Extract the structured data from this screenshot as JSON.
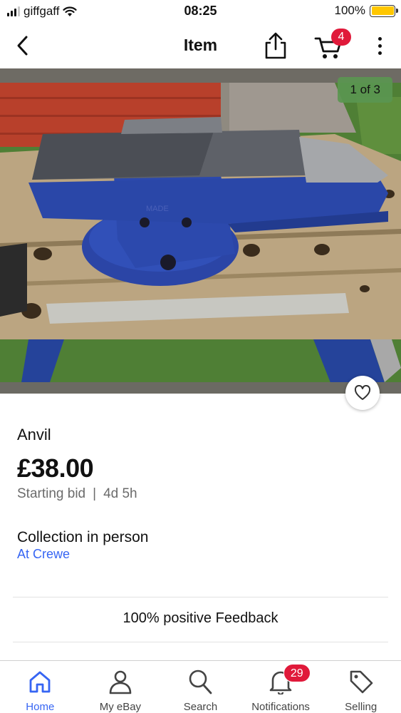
{
  "status_bar": {
    "carrier": "giffgaff",
    "time": "08:25",
    "battery": "100%",
    "battery_level": 1.0,
    "icons": [
      "signal-icon",
      "wifi-icon",
      "battery-icon"
    ]
  },
  "nav": {
    "title": "Item",
    "cart_count": "4",
    "icons": [
      "back-chevron-icon",
      "share-icon",
      "cart-icon",
      "more-vertical-icon"
    ]
  },
  "gallery": {
    "counter": "1 of 3",
    "icons": [
      "heart-icon"
    ]
  },
  "item": {
    "title": "Anvil",
    "price": "£38.00",
    "bid_type": "Starting bid",
    "separator": "|",
    "time_left": "4d 5h",
    "delivery": "Collection in person",
    "location": "At Crewe",
    "feedback": "100% positive Feedback"
  },
  "tabs": [
    {
      "label": "Home",
      "icon": "home-icon",
      "active": true
    },
    {
      "label": "My eBay",
      "icon": "person-icon",
      "active": false
    },
    {
      "label": "Search",
      "icon": "search-icon",
      "active": false
    },
    {
      "label": "Notifications",
      "icon": "bell-icon",
      "active": false,
      "badge": "29"
    },
    {
      "label": "Selling",
      "icon": "tag-icon",
      "active": false
    }
  ],
  "colors": {
    "accent": "#3665f3",
    "badge": "#e0193a",
    "counter_bg": "#5a9650",
    "battery": "#ffc700"
  }
}
